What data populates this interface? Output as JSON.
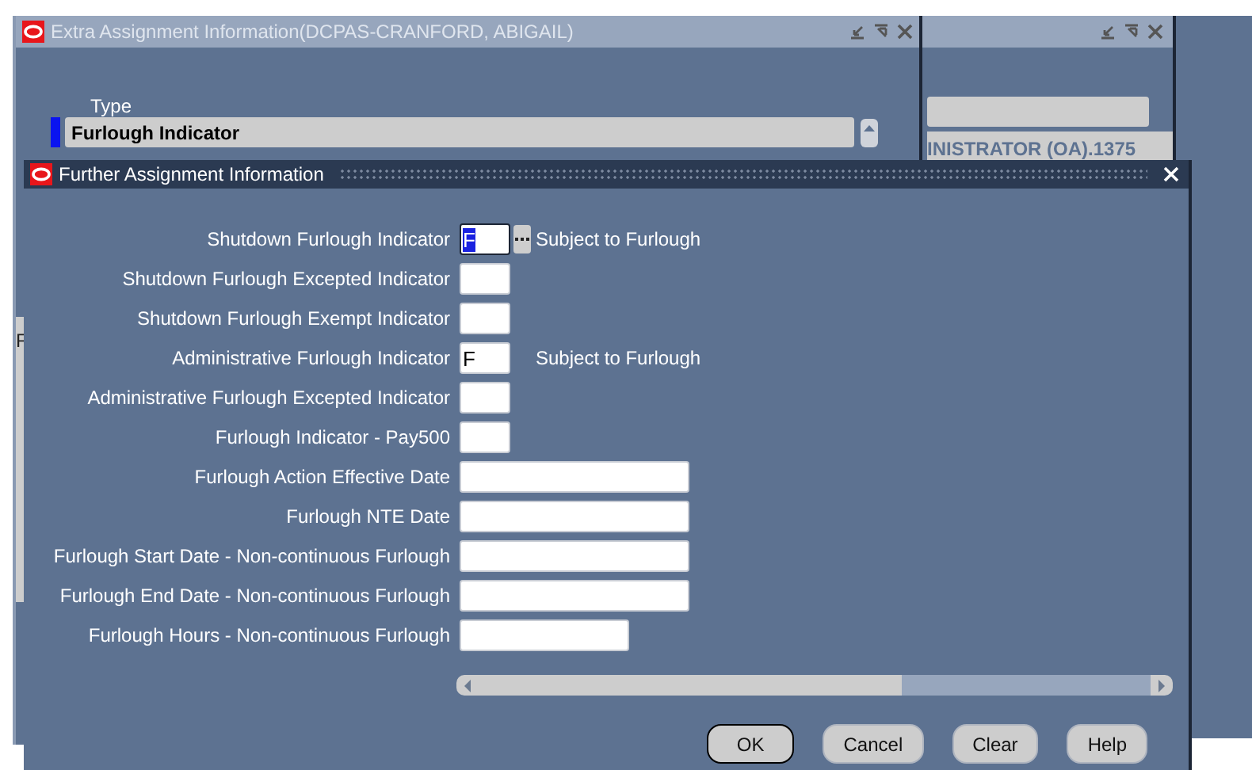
{
  "back_window": {
    "title": "Extra Assignment Information(DCPAS-CRANFORD, ABIGAIL)",
    "type_label": "Type",
    "type_value": "Furlough Indicator",
    "side_text": "F"
  },
  "side_window": {
    "field_text": "INISTRATOR (OA).1375"
  },
  "dialog": {
    "title": "Further Assignment Information",
    "fields": [
      {
        "label": "Shutdown Furlough Indicator",
        "value": "F",
        "kind": "short",
        "selected": true,
        "lov": true,
        "description": "Subject to Furlough"
      },
      {
        "label": "Shutdown Furlough Excepted Indicator",
        "kind": "short",
        "selected": false,
        "lov": false
      },
      {
        "label": "Shutdown Furlough Exempt Indicator",
        "kind": "short",
        "selected": false,
        "lov": false
      },
      {
        "label": "Administrative Furlough Indicator",
        "value": "F",
        "kind": "short",
        "selected": false,
        "lov": false,
        "description": "Subject to Furlough"
      },
      {
        "label": "Administrative Furlough Excepted Indicator",
        "kind": "short",
        "selected": false,
        "lov": false
      },
      {
        "label": "Furlough Indicator - Pay500",
        "kind": "short",
        "selected": false,
        "lov": false
      },
      {
        "label": "Furlough Action Effective Date",
        "kind": "long",
        "selected": false,
        "lov": false
      },
      {
        "label": "Furlough NTE Date",
        "kind": "long",
        "selected": false,
        "lov": false
      },
      {
        "label": "Furlough Start Date - Non-continuous Furlough",
        "kind": "long",
        "selected": false,
        "lov": false
      },
      {
        "label": "Furlough End Date - Non-continuous Furlough",
        "kind": "long",
        "selected": false,
        "lov": false
      },
      {
        "label": "Furlough Hours - Non-continuous Furlough",
        "kind": "medium",
        "selected": false,
        "lov": false
      }
    ],
    "buttons": [
      {
        "label": "OK",
        "default": true
      },
      {
        "label": "Cancel",
        "default": false
      },
      {
        "label": "Clear",
        "default": false
      },
      {
        "label": "Help",
        "default": false
      }
    ]
  }
}
